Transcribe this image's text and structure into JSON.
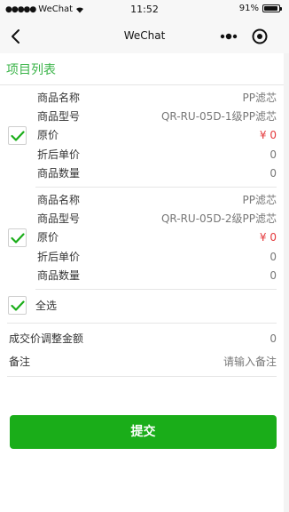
{
  "status_bar": {
    "carrier": "WeChat",
    "time": "11:52",
    "battery": "91%",
    "battery_level": 0.91
  },
  "nav": {
    "title": "WeChat"
  },
  "section_title": "项目列表",
  "items": [
    {
      "checked": true,
      "rows": [
        {
          "label": "商品名称",
          "value": "PP滤芯"
        },
        {
          "label": "商品型号",
          "value": "QR-RU-05D-1级PP滤芯"
        },
        {
          "label": "原价",
          "value": "¥ 0"
        },
        {
          "label": "折后单价",
          "value": "0"
        },
        {
          "label": "商品数量",
          "value": "0"
        }
      ]
    },
    {
      "checked": true,
      "rows": [
        {
          "label": "商品名称",
          "value": "PP滤芯"
        },
        {
          "label": "商品型号",
          "value": "QR-RU-05D-2级PP滤芯"
        },
        {
          "label": "原价",
          "value": "¥ 0"
        },
        {
          "label": "折后单价",
          "value": "0"
        },
        {
          "label": "商品数量",
          "value": "0"
        }
      ]
    }
  ],
  "select_all": {
    "label": "全选",
    "checked": true
  },
  "adjust_amount": {
    "label": "成交价调整金额",
    "value": "0"
  },
  "remark": {
    "label": "备注",
    "placeholder": "请输入备注"
  },
  "submit_label": "提交",
  "colors": {
    "accent_green": "#3bb449",
    "button_green": "#1aad19",
    "price_red": "#e4393c"
  }
}
